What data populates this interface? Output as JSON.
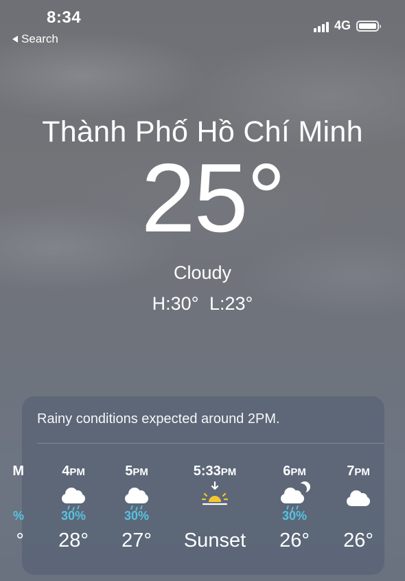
{
  "status_bar": {
    "time": "8:34",
    "back_label": "Search",
    "network": "4G"
  },
  "location": {
    "city": "Thành Phố Hồ Chí Minh",
    "temperature": "25°",
    "condition": "Cloudy",
    "high_low": "H:30° L:23°"
  },
  "hourly_card": {
    "summary": "Rainy conditions expected around 2PM.",
    "partial_left": {
      "label": "M",
      "pct": "%",
      "temp": "°"
    },
    "hours": [
      {
        "time": "4",
        "suffix": "PM",
        "icon": "cloud-rain-icon",
        "precip": "30%",
        "temp": "28°"
      },
      {
        "time": "5",
        "suffix": "PM",
        "icon": "cloud-rain-icon",
        "precip": "30%",
        "temp": "27°"
      },
      {
        "time": "5:33",
        "suffix": "PM",
        "icon": "sunset-icon",
        "precip": "",
        "temp": "Sunset"
      },
      {
        "time": "6",
        "suffix": "PM",
        "icon": "cloud-moon-rain-icon",
        "precip": "30%",
        "temp": "26°"
      },
      {
        "time": "7",
        "suffix": "PM",
        "icon": "cloud-icon",
        "precip": "",
        "temp": "26°"
      }
    ]
  },
  "colors": {
    "precip_blue": "#55c3e3",
    "sun_yellow": "#f5c531"
  }
}
